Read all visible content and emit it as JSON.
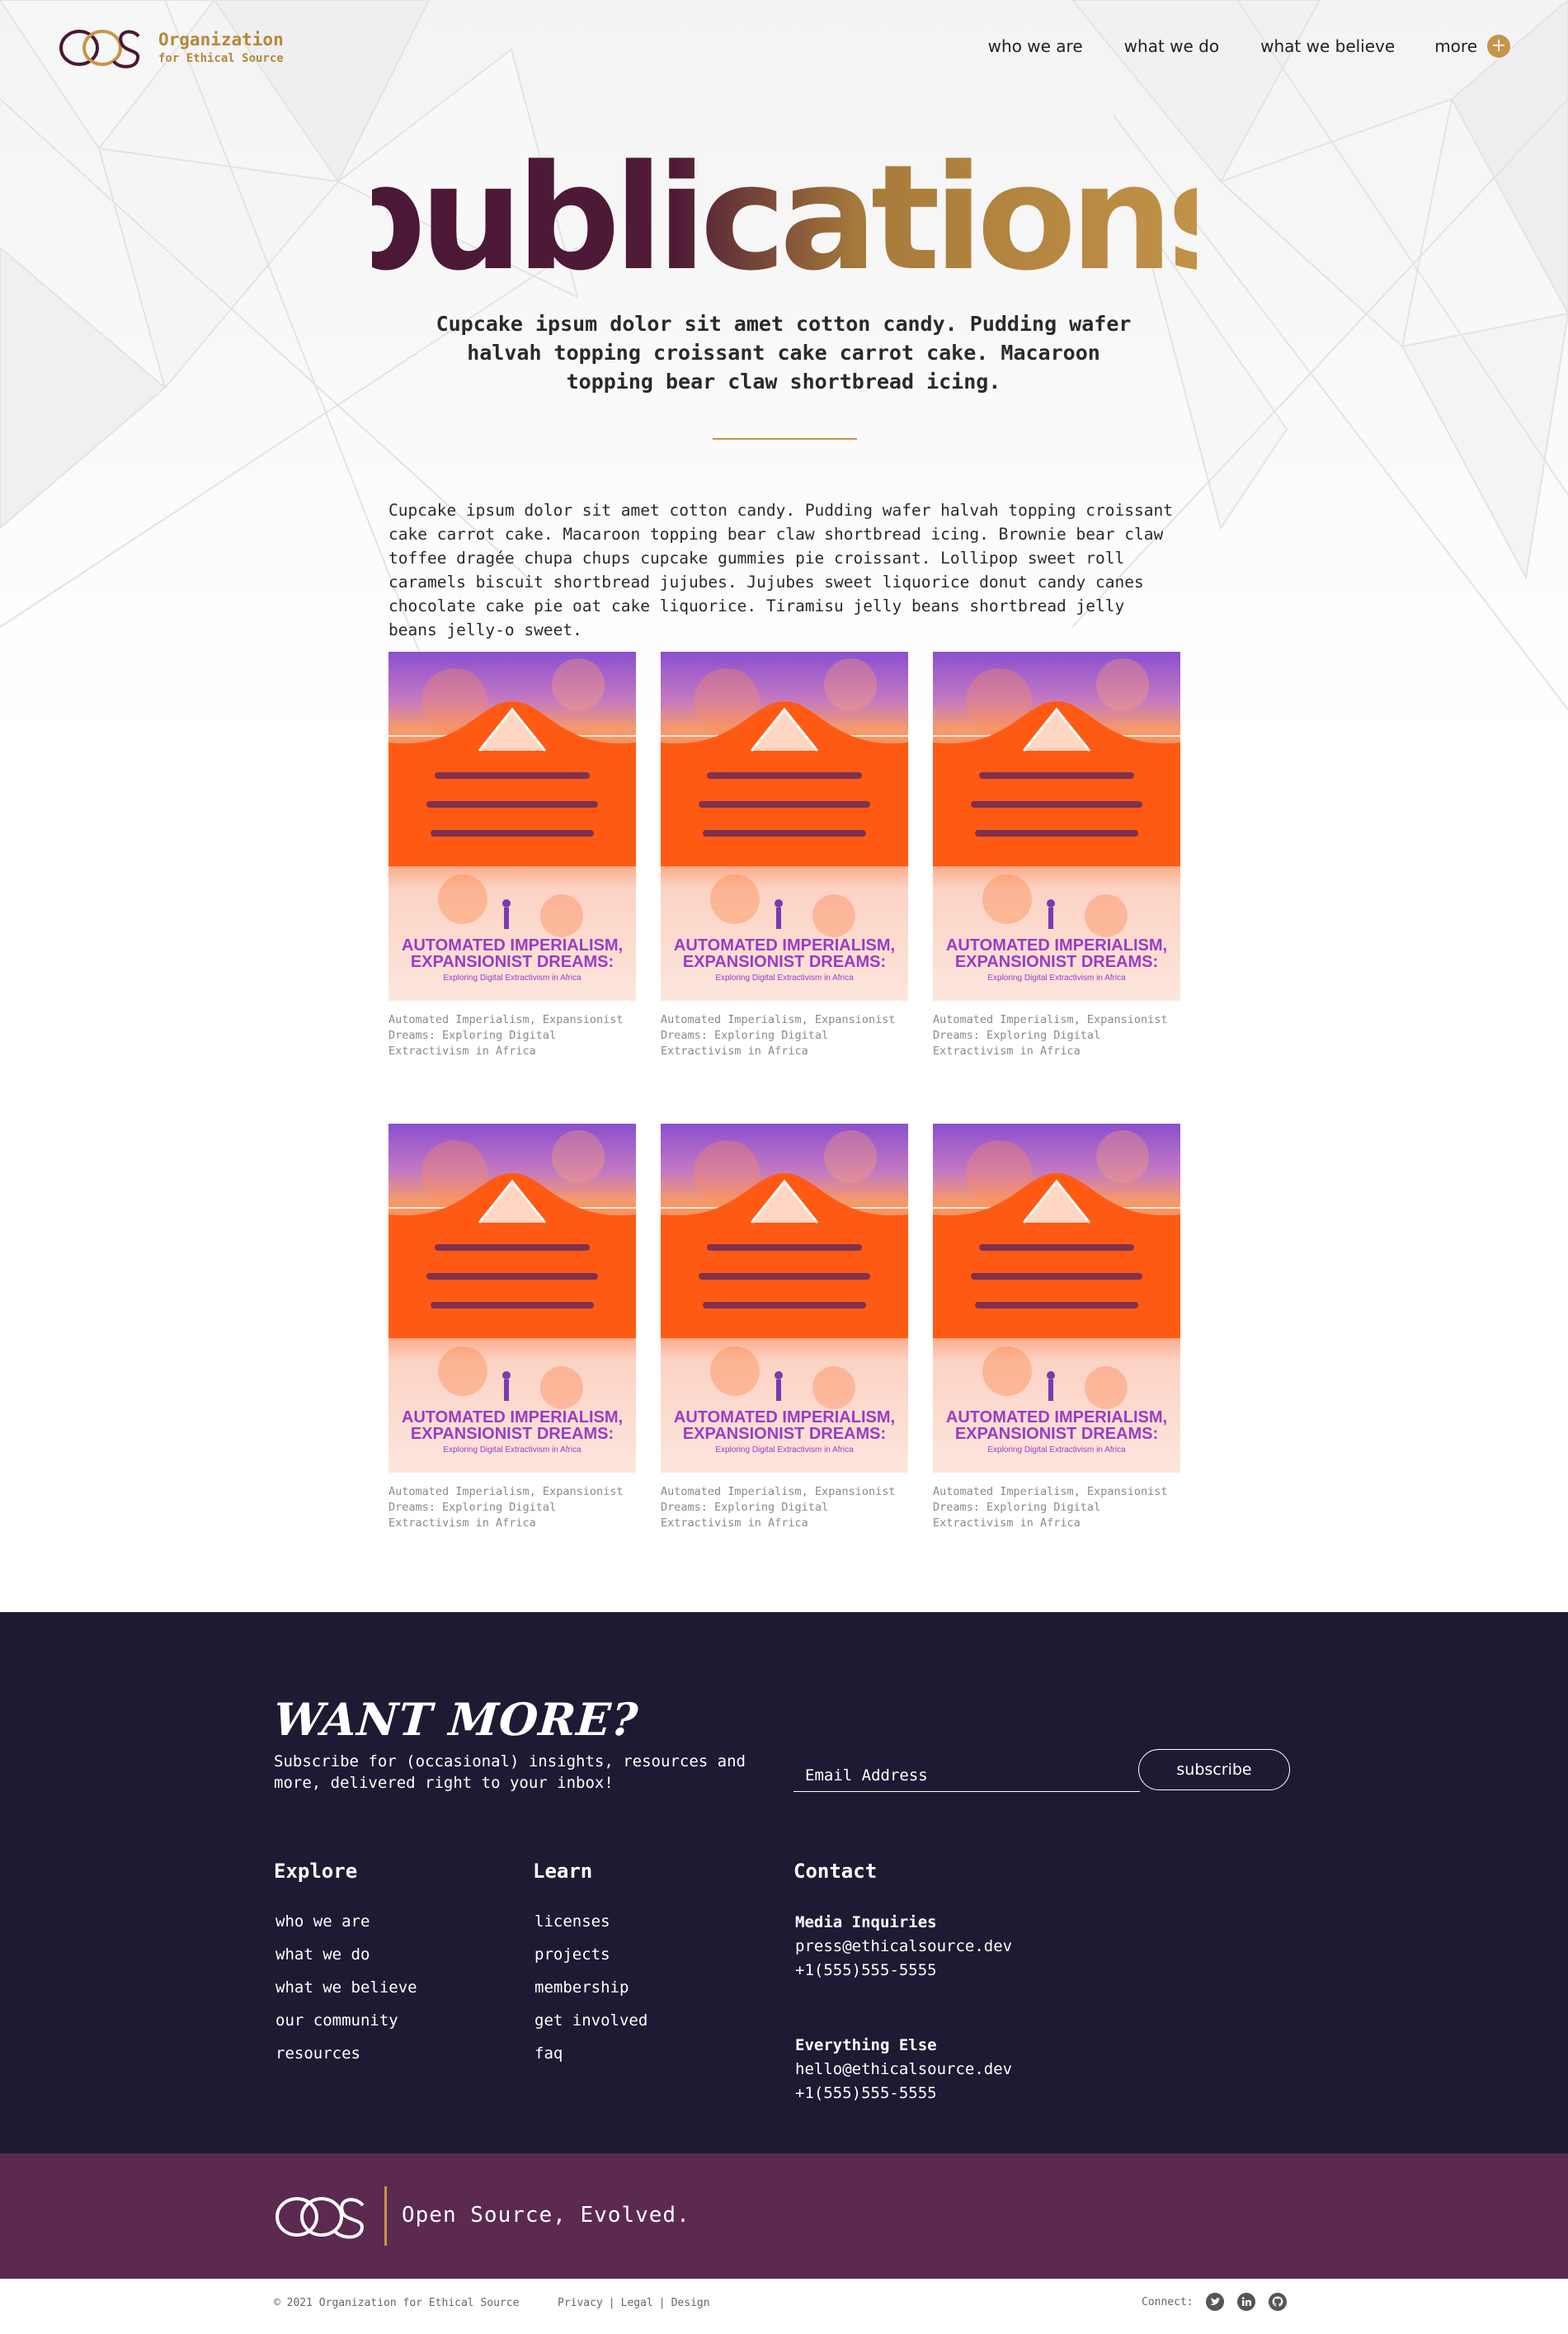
{
  "header": {
    "logo_name": "Organization",
    "logo_tagline": "for Ethical Source",
    "nav": [
      "who we are",
      "what we do",
      "what we believe"
    ],
    "more_label": "more",
    "more_icon": "plus-icon"
  },
  "hero": {
    "title": "publications",
    "subtitle": "Cupcake ipsum dolor sit amet cotton candy. Pudding wafer halvah topping croissant cake carrot cake. Macaroon topping bear claw shortbread icing.",
    "intro": "Cupcake ipsum dolor sit amet cotton candy. Pudding wafer halvah topping croissant cake carrot cake. Macaroon topping bear claw shortbread icing. Brownie bear claw toffee dragée chupa chups cupcake gummies pie croissant. Lollipop sweet roll caramels biscuit shortbread jujubes. Jujubes sweet liquorice donut candy canes chocolate cake pie oat cake liquorice. Tiramisu jelly beans shortbread jelly beans jelly-o sweet."
  },
  "publications": [
    {
      "cover_title_1": "AUTOMATED IMPERIALISM,",
      "cover_title_2": "EXPANSIONIST DREAMS:",
      "cover_sub": "Exploring Digital Extractivism in Africa",
      "caption": "Automated Imperialism, Expansionist Dreams: Exploring Digital Extractivism in Africa"
    },
    {
      "cover_title_1": "AUTOMATED IMPERIALISM,",
      "cover_title_2": "EXPANSIONIST DREAMS:",
      "cover_sub": "Exploring Digital Extractivism in Africa",
      "caption": "Automated Imperialism, Expansionist Dreams: Exploring Digital Extractivism in Africa"
    },
    {
      "cover_title_1": "AUTOMATED IMPERIALISM,",
      "cover_title_2": "EXPANSIONIST DREAMS:",
      "cover_sub": "Exploring Digital Extractivism in Africa",
      "caption": "Automated Imperialism, Expansionist Dreams: Exploring Digital Extractivism in Africa"
    },
    {
      "cover_title_1": "AUTOMATED IMPERIALISM,",
      "cover_title_2": "EXPANSIONIST DREAMS:",
      "cover_sub": "Exploring Digital Extractivism in Africa",
      "caption": "Automated Imperialism, Expansionist Dreams: Exploring Digital Extractivism in Africa"
    },
    {
      "cover_title_1": "AUTOMATED IMPERIALISM,",
      "cover_title_2": "EXPANSIONIST DREAMS:",
      "cover_sub": "Exploring Digital Extractivism in Africa",
      "caption": "Automated Imperialism, Expansionist Dreams: Exploring Digital Extractivism in Africa"
    },
    {
      "cover_title_1": "AUTOMATED IMPERIALISM,",
      "cover_title_2": "EXPANSIONIST DREAMS:",
      "cover_sub": "Exploring Digital Extractivism in Africa",
      "caption": "Automated Imperialism, Expansionist Dreams: Exploring Digital Extractivism in Africa"
    }
  ],
  "newsletter": {
    "heading": "WANT MORE?",
    "text": "Subscribe for (occasional) insights, resources and more, delivered right to your inbox!",
    "email_placeholder": "Email Address",
    "button": "subscribe"
  },
  "footer": {
    "explore": {
      "heading": "Explore",
      "links": [
        "who we are",
        "what we do",
        "what we believe",
        "our community",
        "resources"
      ]
    },
    "learn": {
      "heading": "Learn",
      "links": [
        "licenses",
        "projects",
        "membership",
        "get involved",
        "faq"
      ]
    },
    "contact": {
      "heading": "Contact",
      "media_label": "Media Inquiries",
      "media_email": "press@ethicalsource.dev",
      "media_phone": "+1(555)555-5555",
      "else_label": "Everything Else",
      "else_email": "hello@ethicalsource.dev",
      "else_phone": "+1(555)555-5555"
    }
  },
  "band": {
    "slogan": "Open Source, Evolved."
  },
  "bottom": {
    "copyright": "© 2021 Organization for Ethical Source",
    "links": [
      "Privacy",
      "Legal",
      "Design"
    ],
    "connect_label": "Connect:",
    "social_icons": [
      "twitter-icon",
      "linkedin-icon",
      "github-icon"
    ]
  },
  "colors": {
    "gold": "#c6954a",
    "plum": "#4a1736",
    "navy": "#1e1a33",
    "band_purple": "#5c2951"
  }
}
